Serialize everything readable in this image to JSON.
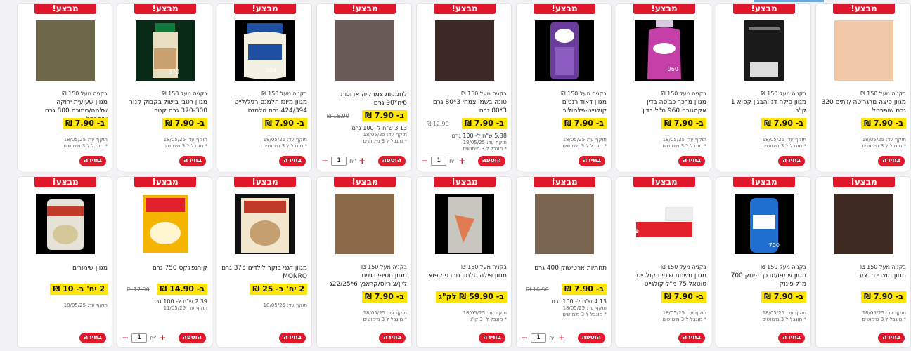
{
  "badge": "מבצע!",
  "pick_label": "בחירה",
  "add_label": "הוספה",
  "unit_label": "יח'",
  "qty_value": "1",
  "rows": [
    [
      {
        "limit": "בקניה מעל 150 ₪",
        "name": "מגוון פיצה מרגריטה /זיתים 320 גרם שופרסל",
        "price": "ב- 7.90 ₪",
        "valid": "תוקף עד: 18/05/25",
        "note": "* מוגבל ל 3 מימושים",
        "img": "beige",
        "action": "pick"
      },
      {
        "limit": "בקניה מעל 150 ₪",
        "name": "מגוון פילה דג והבגון קפוא 1 ק\"ג",
        "price": "ב- 7.90 ₪",
        "valid": "תוקף עד: 18/05/25",
        "note": "* מוגבל ל 3 מימושים",
        "img": "pack-dark",
        "action": "pick"
      },
      {
        "limit": "בקניה מעל 150 ₪",
        "name": "מגוון מרכך כביסה בדין אקסטרה 960 מ\"ל בדין",
        "price": "ב- 7.90 ₪",
        "valid": "תוקף עד: 18/05/25",
        "note": "* מוגבל ל 3 מימושים",
        "img": "bottle-pink",
        "action": "pick"
      },
      {
        "limit": "בקניה מעל 150 ₪",
        "name": "מגוון דאודורנטים קולגייט-פלמוליב",
        "price": "ב- 7.90 ₪",
        "valid": "תוקף עד: 18/05/25",
        "note": "* מוגבל ל 3 מימושים",
        "img": "deo-purple",
        "action": "pick"
      },
      {
        "limit": "בקניה מעל 150 ₪",
        "name": "טונה בשמן צמחי 3*80 גרם 3*80 גרם",
        "price": "ב- 7.90 ₪",
        "old": "12.90 ₪",
        "unit": "5.38 ש\"ח ל- 100 גרם",
        "valid": "תוקף עד: 18/05/25",
        "note": "* מוגבל ל 3 מימושים",
        "img": "dark-brown",
        "action": "add"
      },
      {
        "limit": "",
        "name": "לחמניות צמרקיה ארוכות 6יח*90 גרם",
        "price": "ב- 7.90 ₪",
        "old": "16.90 ₪",
        "unit": "3.13 ש\"ח ל- 100 גרם",
        "valid": "תוקף עד: 18/05/25",
        "note": "* מוגבל ל 3 מימושים",
        "img": "mid-brown",
        "action": "add"
      },
      {
        "limit": "בקניה מעל 150 ₪",
        "name": "מגוון מיונז הלמנס רגיל/לייט 424/394 גרם הלמנס",
        "price": "ב- 7.90 ₪",
        "valid": "תוקף עד: 18/05/25",
        "note": "* מוגבל ל 3 מימושים",
        "img": "mayo-jar",
        "action": "pick"
      },
      {
        "limit": "בקניה מעל 150 ₪",
        "name": "מגוון רטבי בישול בקבוק קנור 370-300 גרם קנור",
        "price": "ב- 7.90 ₪",
        "valid": "תוקף עד: 18/05/25",
        "note": "* מוגבל ל 3 מימושים",
        "img": "green-bottle",
        "action": "pick"
      },
      {
        "limit": "בקניה מעל 150 ₪",
        "name": "מגוון שעועית ירוקה שלמה/חתוכה 800 גרם שופרסל",
        "price": "ב- 7.90 ₪",
        "valid": "תוקף עד: 18/05/25",
        "note": "* מוגבל ל 3 מימושים",
        "img": "olive",
        "action": "pick"
      }
    ],
    [
      {
        "limit": "בקניה מעל 150 ₪",
        "name": "מגוון מוצרי מבצע",
        "price": "ב- 7.90 ₪",
        "valid": "תוקף עד: 18/05/25",
        "note": "* מוגבל ל 3 מימושים",
        "img": "dark-brown2",
        "action": "pick"
      },
      {
        "limit": "בקניה מעל 150 ₪",
        "name": "מגוון שמפו/מרכך פינוק 700 מ\"ל פינוק",
        "price": "ב- 7.90 ₪",
        "valid": "תוקף עד: 18/05/25",
        "note": "* מוגבל ל 3 מימושים",
        "img": "shampoo-blue",
        "action": "pick"
      },
      {
        "limit": "בקניה מעל 150 ₪",
        "name": "מגוון משחת שיניים קולגייט טוטאל 75 מ\"ל קולגייט",
        "price": "ב- 7.90 ₪",
        "valid": "תוקף עד: 18/05/25",
        "note": "* מוגבל ל 3 מימושים",
        "img": "colgate",
        "action": "pick"
      },
      {
        "limit": "",
        "name": "תחתיות ארטישוק 400 גרם",
        "price": "ב- 7.90 ₪",
        "old": "16.50 ₪",
        "unit": "4.13 ש\"ח ל- 100 גרם",
        "valid": "תוקף עד: 18/05/25",
        "note": "* מוגבל ל 3 מימושים",
        "img": "tan",
        "action": "add"
      },
      {
        "limit": "בקניה מעל 150 ₪",
        "name": "מגוון פילה סלמון נורבגי קפוא",
        "price": "ב- 59.90 ₪ לק\"ג",
        "valid": "תוקף עד: 18/05/25",
        "note": "* מוגבל ל- 3 ק\"ג",
        "img": "fish-pack",
        "action": "pick"
      },
      {
        "limit": "בקניה מעל 150 ₪",
        "name": "מגוון חטיפי דגנים ליון/צ'ריוס/קראנץ 6*22/25ג",
        "price": "ב- 7.90 ₪",
        "valid": "תוקף עד: 18/05/25",
        "note": "* מוגבל ל 3 מימושים",
        "img": "tan2",
        "action": "pick"
      },
      {
        "limit": "",
        "name": "מגוון דגני בוקר לילדים 375 גרם MONRO",
        "price": "2 יח' ב- 25 ₪",
        "valid": "תוקף עד: 18/05/25",
        "note": "",
        "img": "cereal-box",
        "action": "pick"
      },
      {
        "limit": "",
        "name": "קורנפלקס 750 גרם",
        "price": "ב- 14.90 ₪",
        "old": "17.90 ₪",
        "unit": "2.39 ש\"ח ל- 100 גרם",
        "valid": "תוקף עד: 11/05/25",
        "note": "",
        "img": "cornflakes",
        "action": "add"
      },
      {
        "limit": "",
        "name": "מגוון שימורים",
        "price": "2 יח' ב- 10 ₪",
        "valid": "תוקף עד: 18/05/25",
        "note": "",
        "img": "can",
        "action": "pick"
      }
    ]
  ]
}
